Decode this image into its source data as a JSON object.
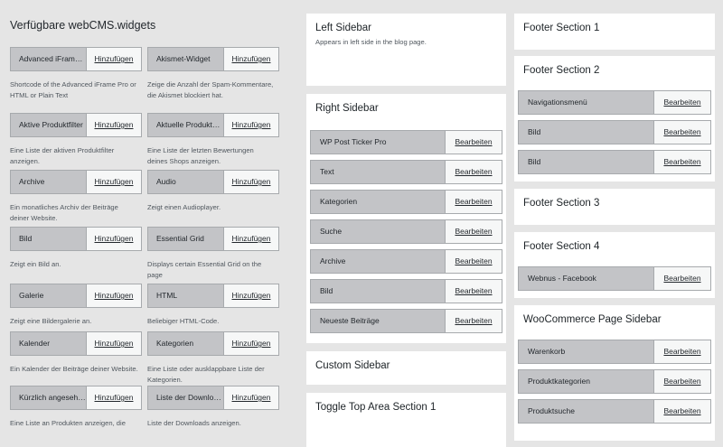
{
  "available": {
    "title": "Verfügbare webCMS.widgets",
    "action_label": "Hinzufügen",
    "widgets": [
      {
        "name": "Advanced iFrame Pro",
        "desc": "Shortcode of the Advanced iFrame Pro or HTML or Plain Text"
      },
      {
        "name": "Akismet-Widget",
        "desc": "Zeige die Anzahl der Spam-Kommentare, die Akismet blockiert hat."
      },
      {
        "name": "Aktive Produktfilter",
        "desc": "Eine Liste der aktiven Produktfilter anzeigen."
      },
      {
        "name": "Aktuelle Produktbewertungen",
        "desc": "Eine Liste der letzten Bewertungen deines Shops anzeigen."
      },
      {
        "name": "Archive",
        "desc": "Ein monatliches Archiv der Beiträge deiner Website."
      },
      {
        "name": "Audio",
        "desc": "Zeigt einen Audioplayer."
      },
      {
        "name": "Bild",
        "desc": "Zeigt ein Bild an."
      },
      {
        "name": "Essential Grid",
        "desc": "Displays certain Essential Grid on the page"
      },
      {
        "name": "Galerie",
        "desc": "Zeigt eine Bildergalerie an."
      },
      {
        "name": "HTML",
        "desc": "Beliebiger HTML-Code."
      },
      {
        "name": "Kalender",
        "desc": "Ein Kalender der Beiträge deiner Website."
      },
      {
        "name": "Kategorien",
        "desc": "Eine Liste oder ausklappbare Liste der Kategorien."
      },
      {
        "name": "Kürzlich angesehene Produkte",
        "desc": "Eine Liste an Produkten anzeigen, die"
      },
      {
        "name": "Liste der Downloads",
        "desc": "Liste der Downloads anzeigen."
      }
    ]
  },
  "edit_label": "Bearbeiten",
  "sidebars_middle": [
    {
      "title": "Left Sidebar",
      "desc": "Appears in left side in the blog page.",
      "widgets": []
    },
    {
      "title": "Right Sidebar",
      "desc": "",
      "widgets": [
        "WP Post Ticker Pro",
        "Text",
        "Kategorien",
        "Suche",
        "Archive",
        "Bild",
        "Neueste Beiträge"
      ]
    },
    {
      "title": "Custom Sidebar",
      "desc": "",
      "widgets": []
    },
    {
      "title": "Toggle Top Area Section 1",
      "desc": "",
      "widgets": []
    }
  ],
  "sidebars_right": [
    {
      "title": "Footer Section 1",
      "desc": "",
      "widgets": []
    },
    {
      "title": "Footer Section 2",
      "desc": "",
      "widgets": [
        "Navigationsmenü",
        "Bild",
        "Bild"
      ]
    },
    {
      "title": "Footer Section 3",
      "desc": "",
      "widgets": []
    },
    {
      "title": "Footer Section 4",
      "desc": "",
      "widgets": [
        "Webnus - Facebook"
      ]
    },
    {
      "title": "WooCommerce Page Sidebar",
      "desc": "",
      "widgets": [
        "Warenkorb",
        "Produktkategorien",
        "Produktsuche"
      ]
    }
  ]
}
